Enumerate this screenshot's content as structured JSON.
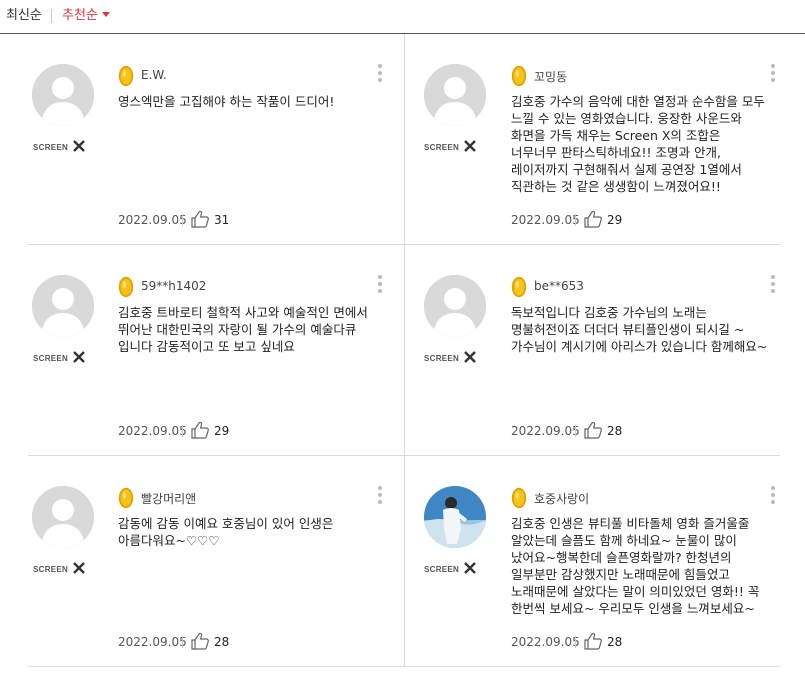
{
  "sort": {
    "latest": "최신순",
    "recommended": "추천순"
  },
  "badge_text": "SCREENX",
  "colors": {
    "accent": "#e2333e",
    "medal": "#f5b800",
    "divider": "#dcdcdc"
  },
  "reviews": [
    {
      "author": "E.W.",
      "text": "영스엑만을 고집해야 하는 작품이 드디어!",
      "date": "2022.09.05",
      "likes": "31",
      "avatar": "default-avatar"
    },
    {
      "author": "꼬밍동",
      "text": "김호중 가수의 음악에 대한 열정과 순수함을 모두 느낄 수 있는 영화였습니다. 웅장한 사운드와 화면을 가득 채우는 Screen X의 조합은 너무너무 판타스틱하네요!! 조명과 안개, 레이저까지 구현해줘서 실제 공연장 1열에서 직관하는 것 같은 생생함이 느껴졌어요!!",
      "date": "2022.09.05",
      "likes": "29",
      "avatar": "default-avatar"
    },
    {
      "author": "59**h1402",
      "text": "김호중 트바로티 철학적 사고와 예술적인 면에서 뛰어난 대한민국의 자랑이 될 가수의 예술다큐 입니다 감동적이고 또 보고 싶네요",
      "date": "2022.09.05",
      "likes": "29",
      "avatar": "default-avatar"
    },
    {
      "author": "be**653",
      "text": "독보적입니다 김호중 가수님의 노래는 명불허전이죠 더더더 뷰티플인생이 되시길 ~ 가수님이 계시기에 아리스가 있습니다 함께해요~",
      "date": "2022.09.05",
      "likes": "28",
      "avatar": "default-avatar"
    },
    {
      "author": "빨강머리앤",
      "text": "감동에 감동 이예요 호중님이 있어 인생은 아름다워요~♡♡♡",
      "date": "2022.09.05",
      "likes": "28",
      "avatar": "default-avatar"
    },
    {
      "author": "호중사랑이",
      "text": "김호중 인생은 뷰티풀 비타돌체 영화 즐거울줄 알았는데 슬픔도 함께 하네요~ 눈물이 많이 났어요~행복한데 슬픈영화랄까? 한청년의 일부분만 감상했지만 노래때문에 힘들었고 노래때문에 살았다는 말이 의미있었던 영화!! 꼭 한번씩 보세요~ 우리모두 인생을 느껴보세요~",
      "date": "2022.09.05",
      "likes": "28",
      "avatar": "photo-avatar"
    }
  ]
}
